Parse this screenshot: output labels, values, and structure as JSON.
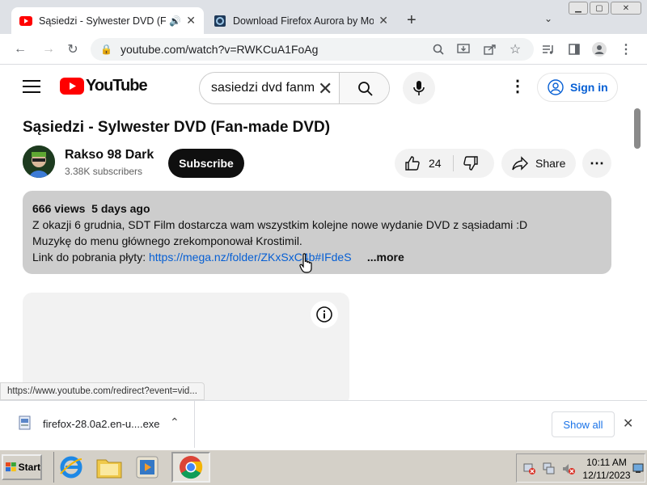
{
  "tabs": [
    {
      "title": "Sąsiedzi - Sylwester DVD (Fan",
      "favicon": "youtube-icon",
      "audio": true
    },
    {
      "title": "Download Firefox Aurora by Moz",
      "favicon": "firefox-aurora-icon"
    }
  ],
  "toolbar": {
    "url": "youtube.com/watch?v=RWKCuA1FoAg"
  },
  "youtube": {
    "logo_text": "YouTube",
    "search_query": "sasiedzi dvd fanm",
    "sign_in": "Sign in",
    "video_title": "Sąsiedzi - Sylwester DVD (Fan-made DVD)",
    "channel_name": "Rakso 98 Dark",
    "subscribers": "3.38K subscribers",
    "subscribe_label": "Subscribe",
    "likes": "24",
    "share_label": "Share",
    "description": {
      "views": "666 views",
      "age": "5 days ago",
      "line1": "Z okazji 6 grudnia, SDT Film dostarcza wam wszystkim kolejne nowe wydanie DVD z sąsiadami :D",
      "line2": "Muzykę do menu głównego zrekomponował Krostimil.",
      "line3_prefix": "Link do pobrania płyty:",
      "link": "https://mega.nz/folder/ZKxSxC4b#IFdeS",
      "more": "...more"
    },
    "status_url": "https://www.youtube.com/redirect?event=vid..."
  },
  "download_bar": {
    "filename": "firefox-28.0a2.en-u....exe",
    "show_all": "Show all"
  },
  "taskbar": {
    "start": "Start",
    "time": "10:11 AM",
    "date": "12/11/2023"
  },
  "colors": {
    "youtube_red": "#ff0000",
    "link_blue": "#065fd4",
    "signin_blue": "#065fd4",
    "desc_bg": "#cdcdcd"
  }
}
